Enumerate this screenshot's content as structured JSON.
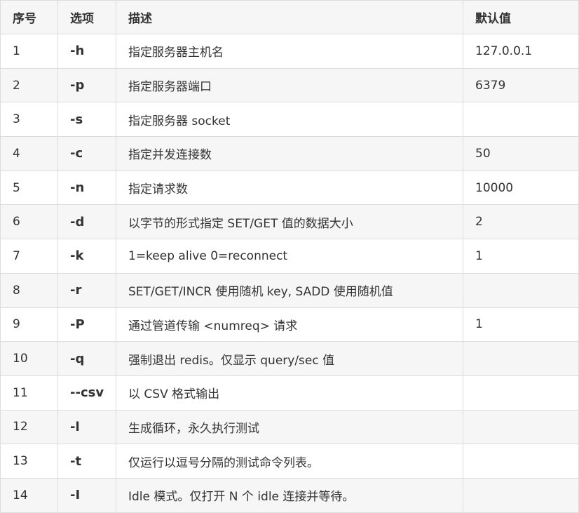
{
  "table": {
    "headers": [
      "序号",
      "选项",
      "描述",
      "默认值"
    ],
    "rows": [
      {
        "num": "1",
        "option": "-h",
        "desc": "指定服务器主机名",
        "default": "127.0.0.1"
      },
      {
        "num": "2",
        "option": "-p",
        "desc": "指定服务器端口",
        "default": "6379"
      },
      {
        "num": "3",
        "option": "-s",
        "desc": "指定服务器 socket",
        "default": ""
      },
      {
        "num": "4",
        "option": "-c",
        "desc": "指定并发连接数",
        "default": "50"
      },
      {
        "num": "5",
        "option": "-n",
        "desc": "指定请求数",
        "default": "10000"
      },
      {
        "num": "6",
        "option": "-d",
        "desc": "以字节的形式指定 SET/GET 值的数据大小",
        "default": "2"
      },
      {
        "num": "7",
        "option": "-k",
        "desc": "1=keep alive 0=reconnect",
        "default": "1"
      },
      {
        "num": "8",
        "option": "-r",
        "desc": "SET/GET/INCR 使用随机 key, SADD 使用随机值",
        "default": ""
      },
      {
        "num": "9",
        "option": "-P",
        "desc": "通过管道传输 <numreq> 请求",
        "default": "1"
      },
      {
        "num": "10",
        "option": "-q",
        "desc": "强制退出 redis。仅显示 query/sec 值",
        "default": ""
      },
      {
        "num": "11",
        "option": "--csv",
        "desc": "以 CSV 格式输出",
        "default": ""
      },
      {
        "num": "12",
        "option": "-l",
        "desc": "生成循环，永久执行测试",
        "default": ""
      },
      {
        "num": "13",
        "option": "-t",
        "desc": "仅运行以逗号分隔的测试命令列表。",
        "default": ""
      },
      {
        "num": "14",
        "option": "-I",
        "desc": "Idle 模式。仅打开 N 个 idle 连接并等待。",
        "default": ""
      }
    ]
  },
  "colors": {
    "border": "#dcdcdc",
    "stripe": "#f6f6f6",
    "text": "#333333"
  }
}
